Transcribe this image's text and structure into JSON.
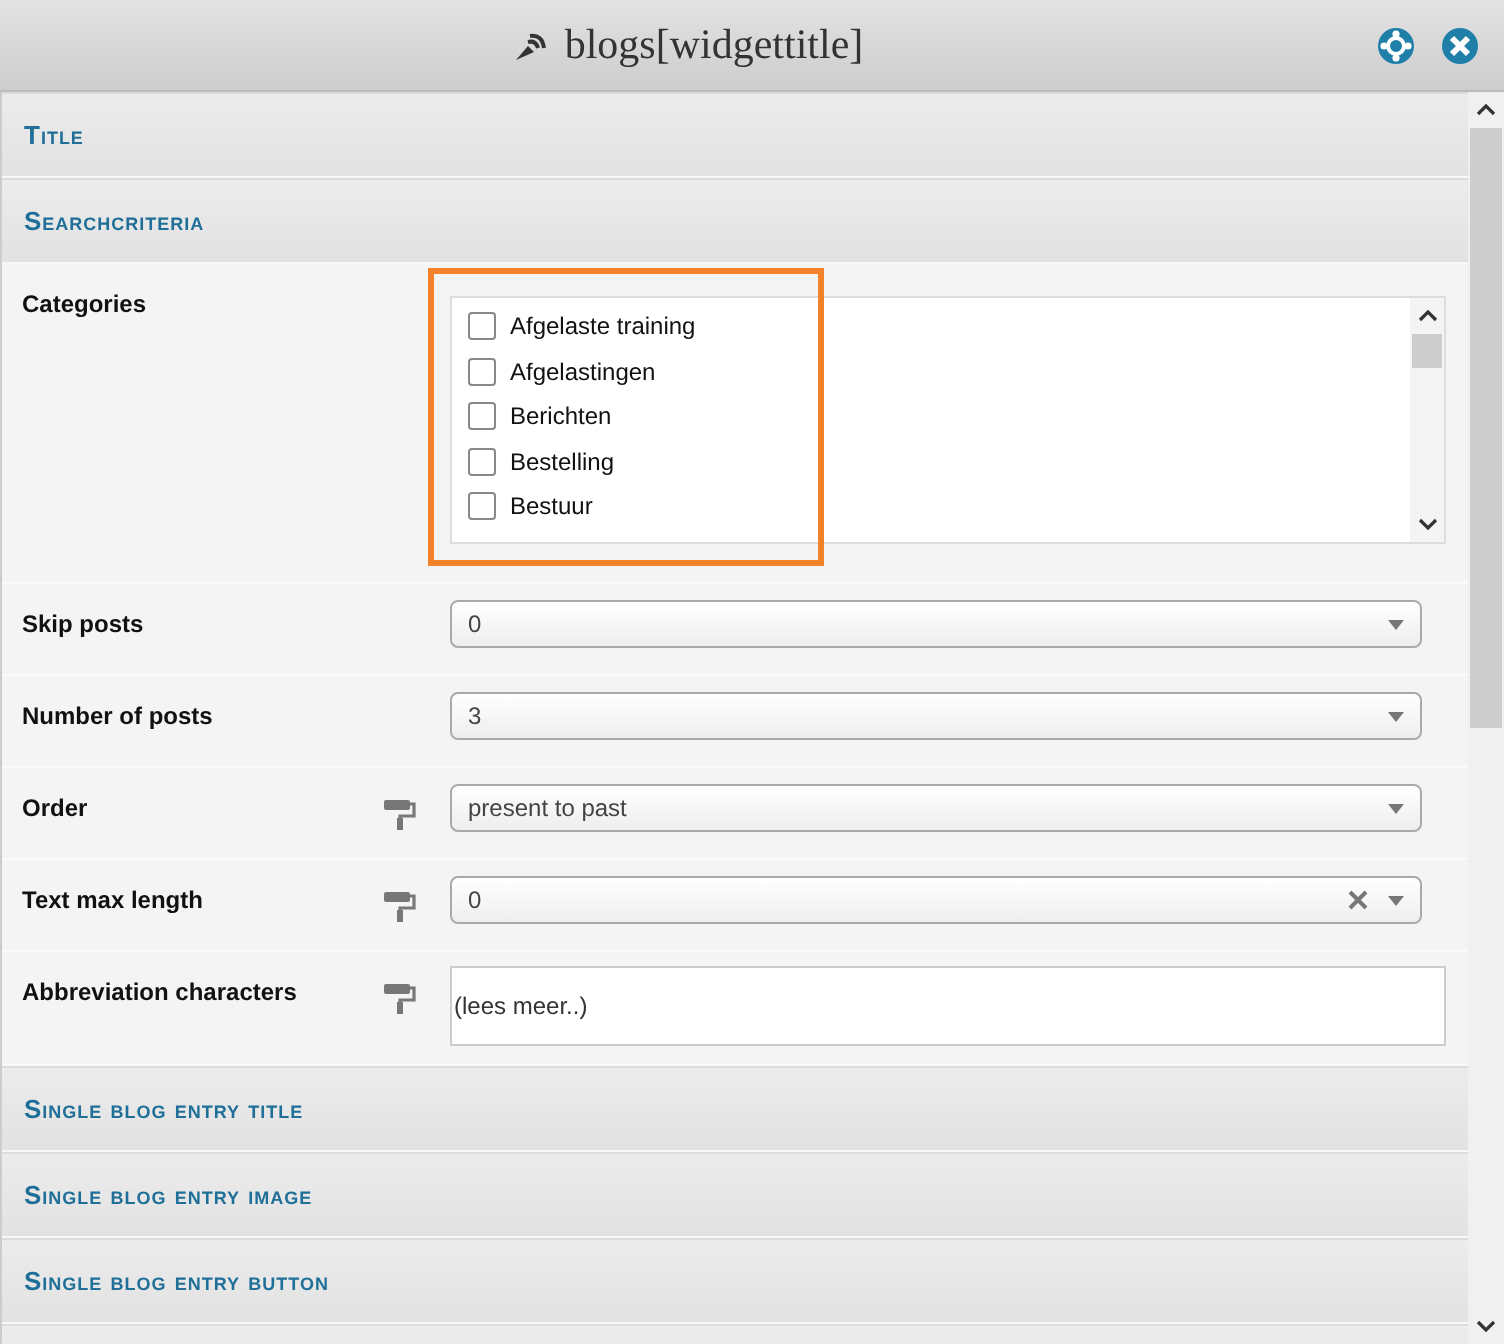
{
  "window": {
    "title": "blogs[widgettitle]"
  },
  "sections_top": [
    {
      "label": "Title"
    },
    {
      "label": "Searchcriteria"
    }
  ],
  "categories": {
    "label": "Categories",
    "highlighted": true,
    "items": [
      {
        "label": "Afgelaste training",
        "checked": false
      },
      {
        "label": "Afgelastingen",
        "checked": false
      },
      {
        "label": "Berichten",
        "checked": false
      },
      {
        "label": "Bestelling",
        "checked": false
      },
      {
        "label": "Bestuur",
        "checked": false
      }
    ]
  },
  "fields": [
    {
      "label": "Skip posts",
      "kind": "select",
      "styled": false,
      "value": "0",
      "clearable": false
    },
    {
      "label": "Number of posts",
      "kind": "select",
      "styled": false,
      "value": "3",
      "clearable": false
    },
    {
      "label": "Order",
      "kind": "select",
      "styled": true,
      "value": "present to past",
      "clearable": false
    },
    {
      "label": "Text max length",
      "kind": "select",
      "styled": true,
      "value": "0",
      "clearable": true
    },
    {
      "label": "Abbreviation characters",
      "kind": "text",
      "styled": true,
      "value": "(lees meer..)"
    }
  ],
  "sections_bottom": [
    {
      "label": "Single blog entry title"
    },
    {
      "label": "Single blog entry image"
    },
    {
      "label": "Single blog entry button"
    }
  ]
}
